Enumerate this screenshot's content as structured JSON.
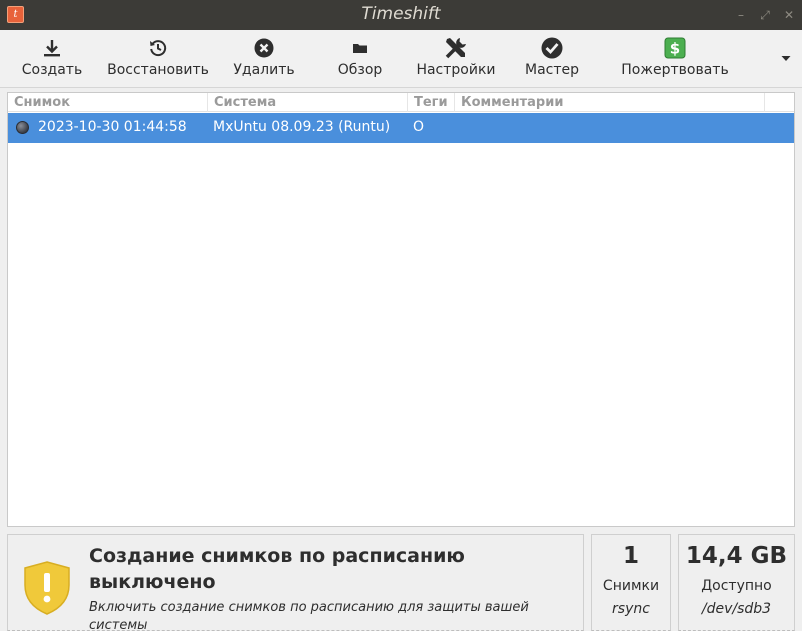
{
  "window": {
    "title": "Timeshift",
    "app_icon_glyph": "t"
  },
  "toolbar": {
    "create": "Создать",
    "restore": "Восстановить",
    "delete": "Удалить",
    "browse": "Обзор",
    "settings": "Настройки",
    "wizard": "Мастер",
    "donate": "Пожертвовать"
  },
  "table": {
    "headers": {
      "snapshot": "Снимок",
      "system": "Система",
      "tags": "Теги",
      "comments": "Комментарии"
    },
    "rows": [
      {
        "snapshot": "2023-10-30 01:44:58",
        "system": "MxUntu 08.09.23 (Runtu)",
        "tags": "O",
        "comments": ""
      }
    ]
  },
  "status": {
    "title": "Создание снимков по расписанию выключено",
    "description": "Включить создание снимков по расписанию для защиты вашей системы"
  },
  "count_panel": {
    "value": "1",
    "label": "Снимки",
    "sub": "rsync"
  },
  "space_panel": {
    "value": "14,4 GB",
    "label": "Доступно",
    "sub": "/dev/sdb3"
  },
  "colors": {
    "selection": "#4a8fdc",
    "titlebar": "#3c3b37",
    "shield": "#f0c93a",
    "donate": "#4caf50"
  }
}
